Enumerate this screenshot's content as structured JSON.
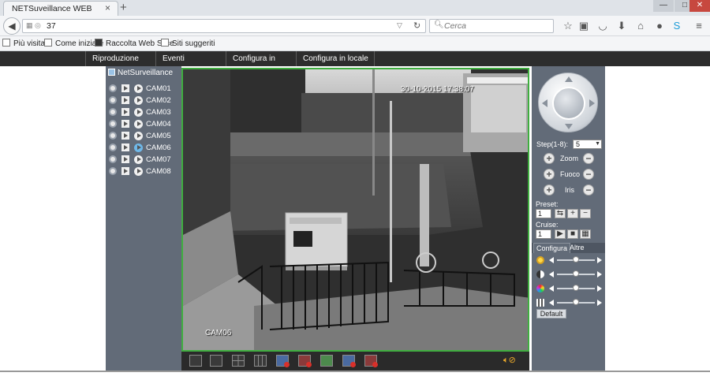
{
  "browser": {
    "tab_title": "NETSuveillance WEB",
    "tab_close": "×",
    "new_tab": "+",
    "url": "37",
    "search_placeholder": "Cerca",
    "window_buttons": {
      "min": "—",
      "max": "□",
      "close": "✕"
    }
  },
  "bookmarks": [
    {
      "label": "Più visitati"
    },
    {
      "label": "Come iniziare"
    },
    {
      "label": "Raccolta Web Slice"
    },
    {
      "label": "Siti suggeriti"
    }
  ],
  "menu": [
    {
      "label": "Riproduzione"
    },
    {
      "label": "Eventi"
    },
    {
      "label": "Configura in remoto"
    },
    {
      "label": "Configura in locale"
    }
  ],
  "camera_tree": {
    "root": "NetSurveillance",
    "cameras": [
      "CAM01",
      "CAM02",
      "CAM03",
      "CAM04",
      "CAM05",
      "CAM06",
      "CAM07",
      "CAM08"
    ],
    "active_camera": "CAM06"
  },
  "video": {
    "timestamp": "30-10-2015 17:38:07",
    "camera_label": "CAM06"
  },
  "ptz": {
    "step_label": "Step(1-8):",
    "step_value": "5",
    "zoom_label": "Zoom",
    "focus_label": "Fuoco",
    "iris_label": "Iris",
    "preset_label": "Preset:",
    "preset_value": "1",
    "cruise_label": "Cruise:",
    "cruise_value": "1",
    "tabs": [
      "Configura",
      "Altre"
    ],
    "default_label": "Default",
    "sliders": [
      {
        "name": "brightness",
        "level": 0.5
      },
      {
        "name": "contrast",
        "level": 0.5
      },
      {
        "name": "saturation",
        "level": 0.5
      },
      {
        "name": "hue",
        "level": 0.5
      }
    ]
  },
  "colors": {
    "menubar": "#2d2d2d",
    "panel": "#626b78",
    "video_border": "#3fae3f"
  }
}
